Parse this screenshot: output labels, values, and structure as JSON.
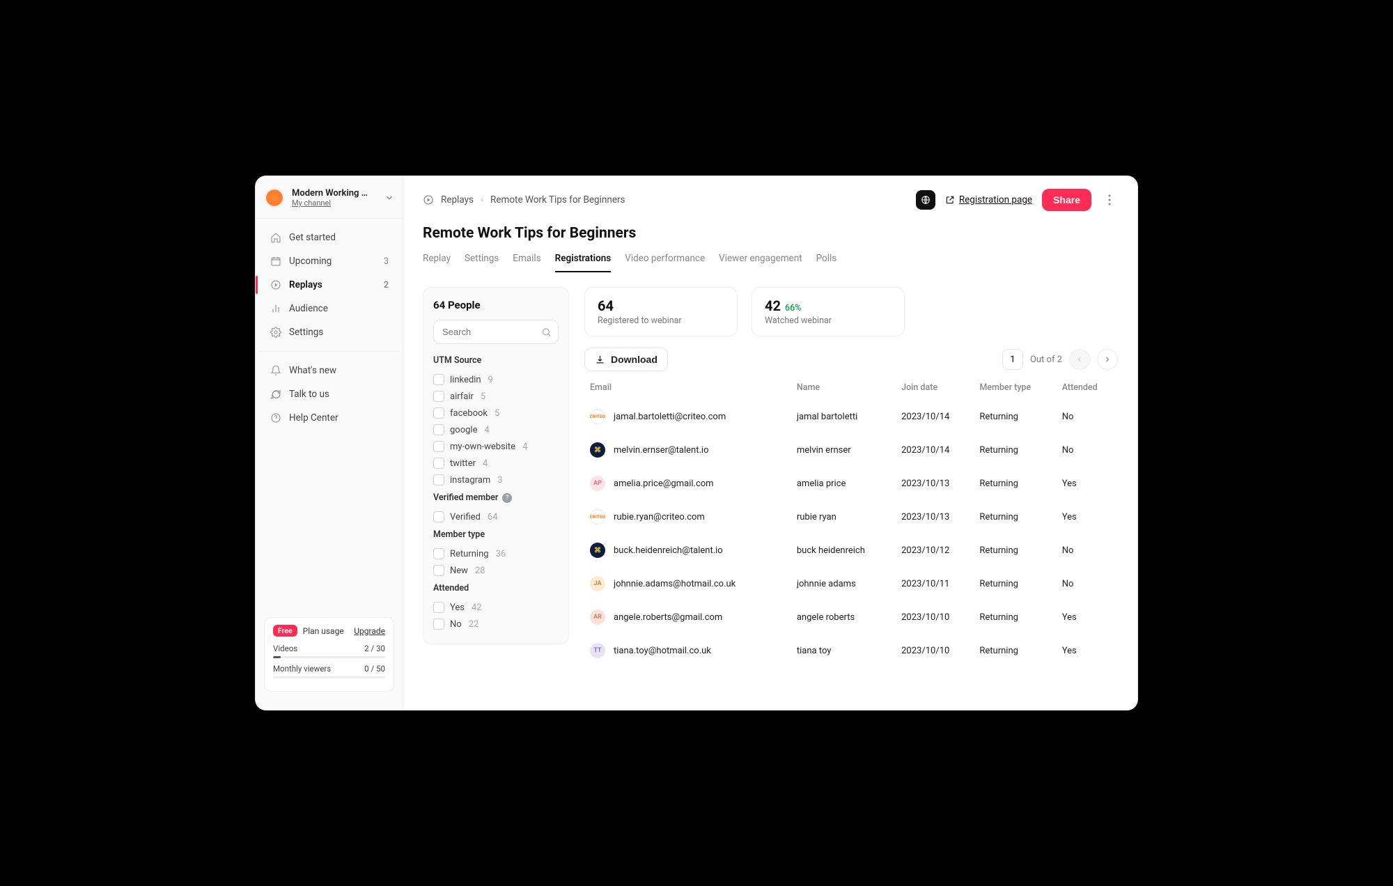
{
  "sidebar": {
    "channel_title": "Modern Working …",
    "channel_subtitle": "My channel",
    "nav": [
      {
        "label": "Get started"
      },
      {
        "label": "Upcoming",
        "count": "3"
      },
      {
        "label": "Replays",
        "count": "2",
        "active": true
      },
      {
        "label": "Audience"
      },
      {
        "label": "Settings"
      }
    ],
    "nav2": [
      {
        "label": "What's new"
      },
      {
        "label": "Talk to us"
      },
      {
        "label": "Help Center"
      }
    ],
    "plan": {
      "badge": "Free",
      "label": "Plan usage",
      "upgrade": "Upgrade",
      "rows": [
        {
          "name": "Videos",
          "value": "2 / 30",
          "pct": 7
        },
        {
          "name": "Monthly viewers",
          "value": "0 / 50",
          "pct": 0
        }
      ]
    }
  },
  "header": {
    "crumb_root": "Replays",
    "crumb_current": "Remote Work Tips for Beginners",
    "reg_link": "Registration page",
    "share": "Share"
  },
  "page_title": "Remote Work Tips for Beginners",
  "tabs": [
    "Replay",
    "Settings",
    "Emails",
    "Registrations",
    "Video performance",
    "Viewer engagement",
    "Polls"
  ],
  "active_tab": "Registrations",
  "filters": {
    "title": "64 People",
    "search_placeholder": "Search",
    "groups": [
      {
        "label": "UTM Source",
        "options": [
          {
            "label": "linkedin",
            "count": "9"
          },
          {
            "label": "airfair",
            "count": "5"
          },
          {
            "label": "facebook",
            "count": "5"
          },
          {
            "label": "google",
            "count": "4"
          },
          {
            "label": "my-own-website",
            "count": "4"
          },
          {
            "label": "twitter",
            "count": "4"
          },
          {
            "label": "instagram",
            "count": "3"
          }
        ]
      },
      {
        "label": "Verified member",
        "help": true,
        "options": [
          {
            "label": "Verified",
            "count": "64"
          }
        ]
      },
      {
        "label": "Member type",
        "options": [
          {
            "label": "Returning",
            "count": "36"
          },
          {
            "label": "New",
            "count": "28"
          }
        ]
      },
      {
        "label": "Attended",
        "options": [
          {
            "label": "Yes",
            "count": "42"
          },
          {
            "label": "No",
            "count": "22"
          }
        ]
      }
    ]
  },
  "stats": [
    {
      "value": "64",
      "label": "Registered to webinar"
    },
    {
      "value": "42",
      "pct": "66%",
      "label": "Watched webinar"
    }
  ],
  "table": {
    "download": "Download",
    "page": "1",
    "out_of": "Out of 2",
    "columns": [
      "Email",
      "Name",
      "Join date",
      "Member type",
      "Attended"
    ],
    "rows": [
      {
        "avatar": {
          "type": "company",
          "text": "CRITEO"
        },
        "email": "jamal.bartoletti@criteo.com",
        "name": "jamal bartoletti",
        "date": "2023/10/14",
        "mtype": "Returning",
        "attended": "No"
      },
      {
        "avatar": {
          "type": "talent",
          "text": "⌘"
        },
        "email": "melvin.ernser@talent.io",
        "name": "melvin ernser",
        "date": "2023/10/14",
        "mtype": "Returning",
        "attended": "No"
      },
      {
        "avatar": {
          "type": "initials",
          "class": "",
          "text": "AP"
        },
        "email": "amelia.price@gmail.com",
        "name": "amelia price",
        "date": "2023/10/13",
        "mtype": "Returning",
        "attended": "Yes"
      },
      {
        "avatar": {
          "type": "company",
          "text": "CRITEO"
        },
        "email": "rubie.ryan@criteo.com",
        "name": "rubie ryan",
        "date": "2023/10/13",
        "mtype": "Returning",
        "attended": "Yes"
      },
      {
        "avatar": {
          "type": "talent",
          "text": "⌘"
        },
        "email": "buck.heidenreich@talent.io",
        "name": "buck heidenreich",
        "date": "2023/10/12",
        "mtype": "Returning",
        "attended": "No"
      },
      {
        "avatar": {
          "type": "initials",
          "class": "ja",
          "text": "JA"
        },
        "email": "johnnie.adams@hotmail.co.uk",
        "name": "johnnie adams",
        "date": "2023/10/11",
        "mtype": "Returning",
        "attended": "No"
      },
      {
        "avatar": {
          "type": "initials",
          "class": "ar",
          "text": "AR"
        },
        "email": "angele.roberts@gmail.com",
        "name": "angele roberts",
        "date": "2023/10/10",
        "mtype": "Returning",
        "attended": "Yes"
      },
      {
        "avatar": {
          "type": "initials",
          "class": "tt",
          "text": "TT"
        },
        "email": "tiana.toy@hotmail.co.uk",
        "name": "tiana toy",
        "date": "2023/10/10",
        "mtype": "Returning",
        "attended": "Yes"
      }
    ]
  }
}
